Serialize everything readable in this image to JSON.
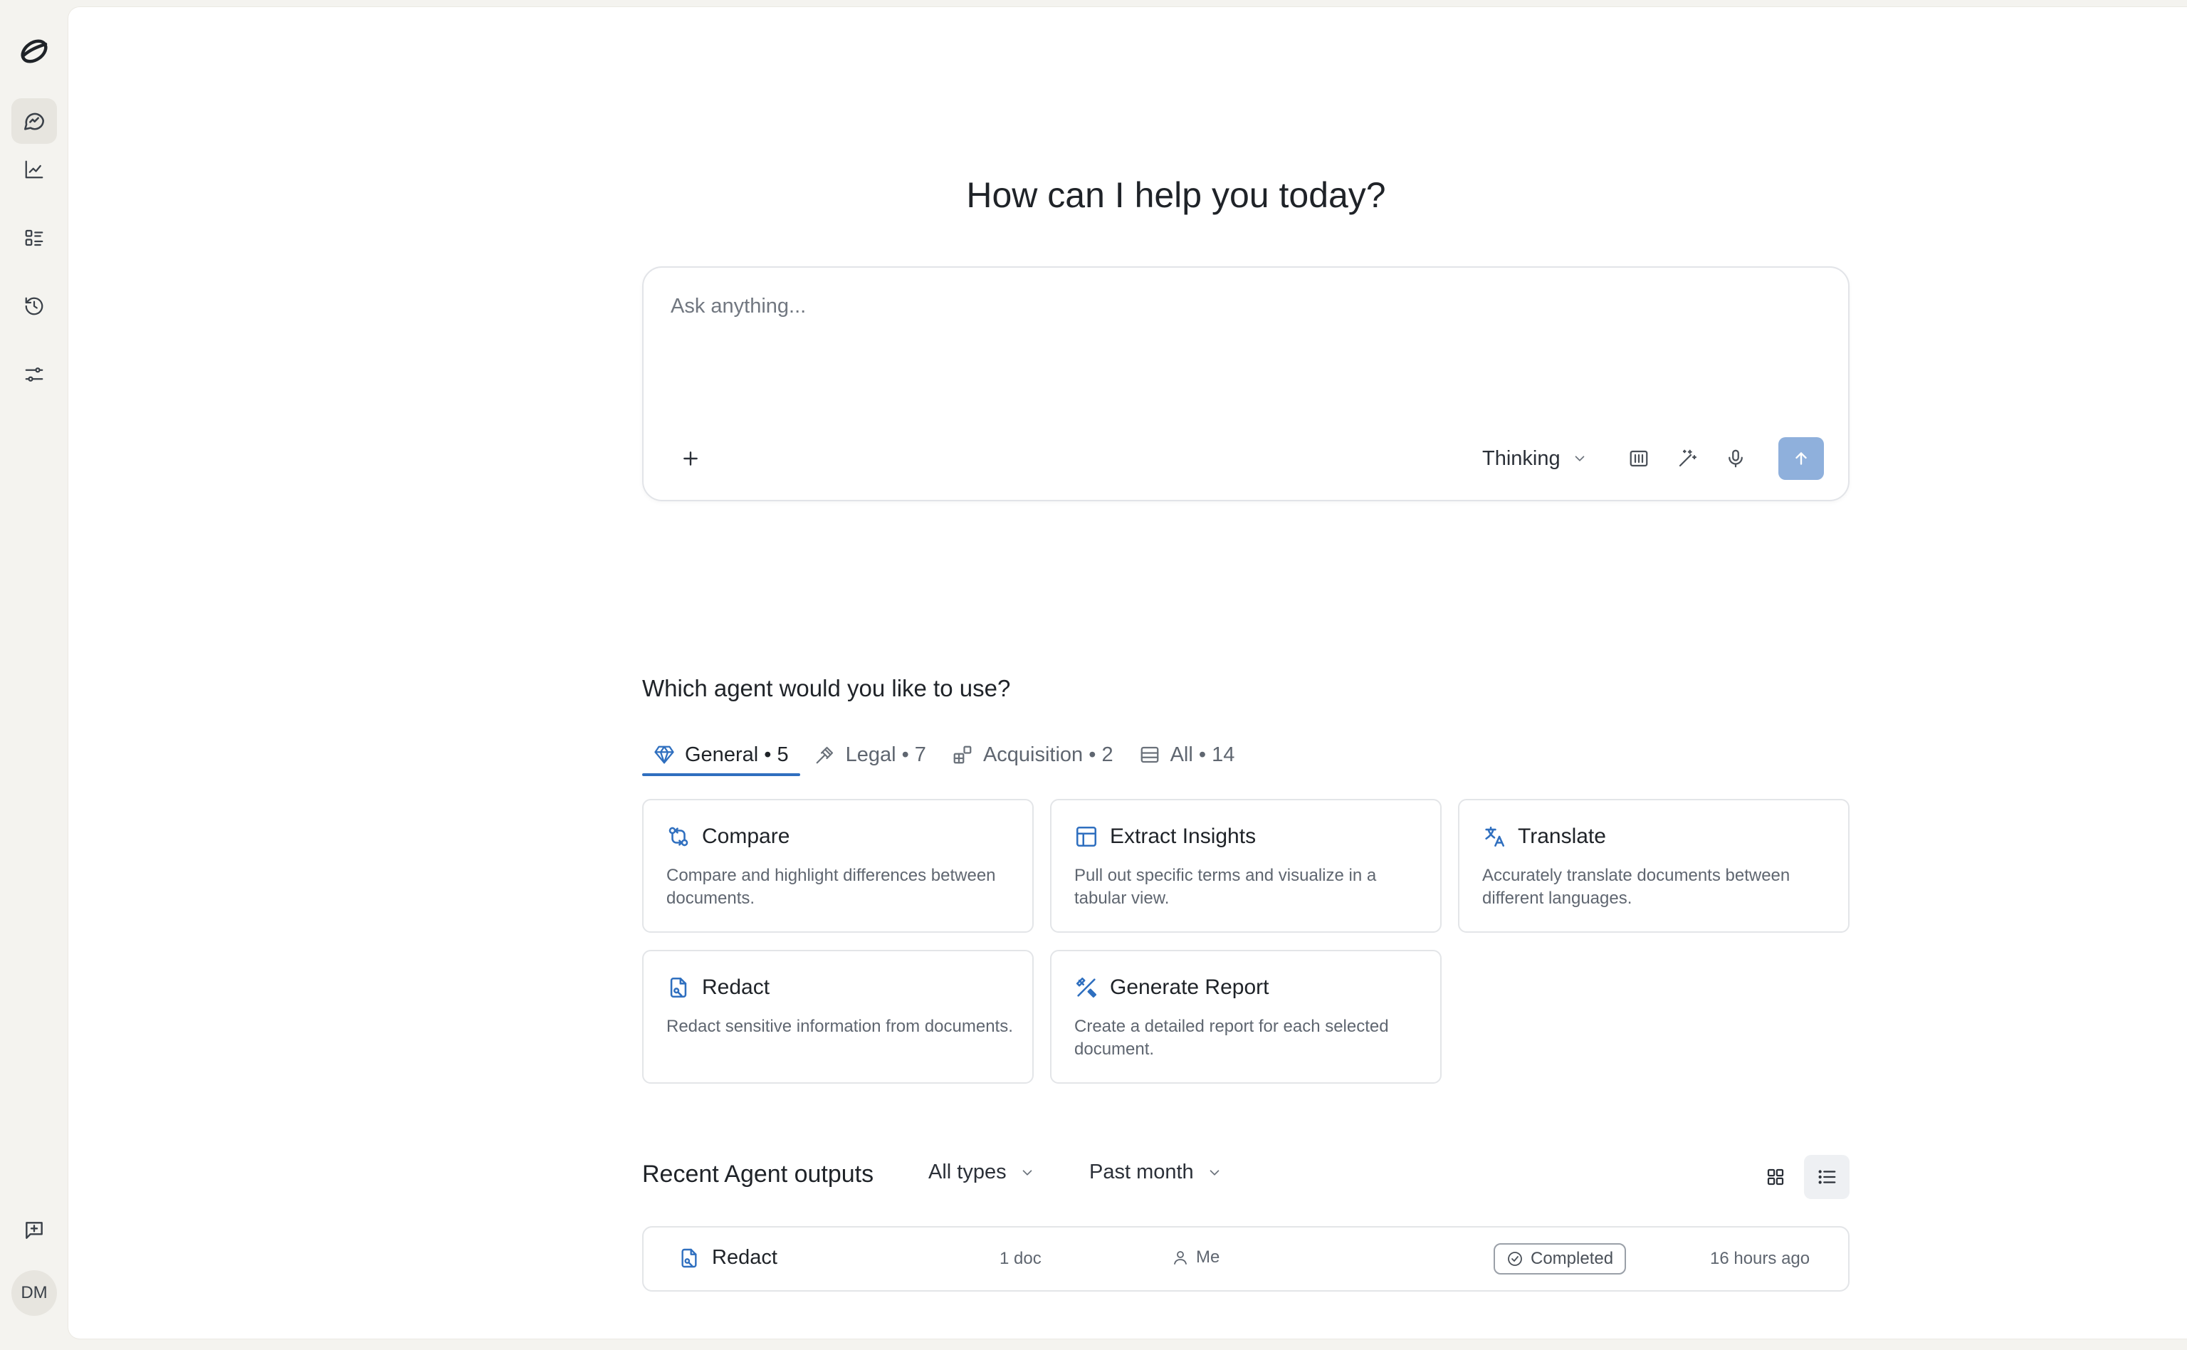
{
  "sidebar": {
    "logo": "app-logo-icon",
    "items": [
      {
        "name": "agents",
        "icon": "agent-chat-icon",
        "active": true
      },
      {
        "name": "analytics",
        "icon": "chart-icon",
        "active": false
      },
      {
        "name": "library",
        "icon": "list-icon",
        "active": false
      },
      {
        "name": "history",
        "icon": "history-icon",
        "active": false
      },
      {
        "name": "settings",
        "icon": "sliders-icon",
        "active": false
      }
    ],
    "feedback_icon": "feedback-icon",
    "avatar_initials": "DM"
  },
  "headline": "How can I help you today?",
  "prompt": {
    "placeholder": "Ask anything...",
    "mode_label": "Thinking",
    "colors": {
      "send_button": "#8fb0dc",
      "accent": "#2f6fbf"
    }
  },
  "agents": {
    "title": "Which agent would you like to use?",
    "tabs": [
      {
        "label": "General • 5",
        "icon": "gem-icon",
        "active": true
      },
      {
        "label": "Legal • 7",
        "icon": "gavel-icon",
        "active": false
      },
      {
        "label": "Acquisition • 2",
        "icon": "blocks-icon",
        "active": false
      },
      {
        "label": "All • 14",
        "icon": "table-icon",
        "active": false
      }
    ],
    "cards": [
      {
        "title": "Compare",
        "desc": "Compare and highlight differences between documents.",
        "icon": "compare-icon"
      },
      {
        "title": "Extract Insights",
        "desc": "Pull out specific terms and visualize in a tabular view.",
        "icon": "table-icon"
      },
      {
        "title": "Translate",
        "desc": "Accurately translate documents between different languages.",
        "icon": "translate-icon"
      },
      {
        "title": "Redact",
        "desc": "Redact sensitive information from documents.",
        "icon": "file-redact-icon"
      },
      {
        "title": "Generate Report",
        "desc": "Create a detailed report for each selected document.",
        "icon": "report-icon"
      }
    ]
  },
  "recent": {
    "title": "Recent Agent outputs",
    "type_filter": "All types",
    "time_filter": "Past month",
    "rows": [
      {
        "name": "Redact",
        "docs": "1 doc",
        "owner": "Me",
        "status": "Completed",
        "time": "16 hours ago"
      }
    ]
  }
}
